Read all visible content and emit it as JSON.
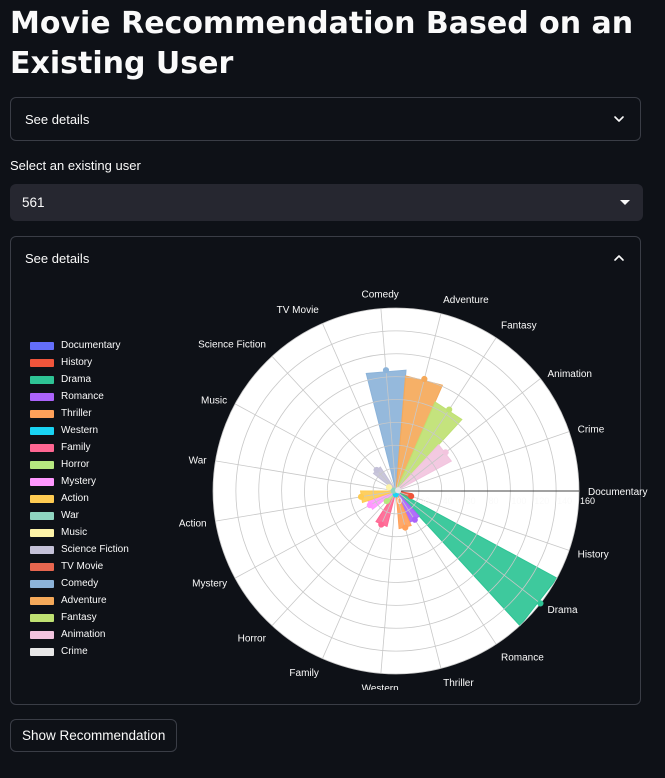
{
  "page": {
    "title": "Movie Recommendation Based on an Existing User"
  },
  "expander_top": {
    "label": "See details",
    "state": "collapsed"
  },
  "user_select": {
    "label": "Select an existing user",
    "value": "561"
  },
  "expander_chart": {
    "label": "See details",
    "state": "expanded"
  },
  "button": {
    "label": "Show Recommendation"
  },
  "chart_data": {
    "type": "radar",
    "title": "",
    "radial_range": [
      0,
      160
    ],
    "radial_ticks": [
      "0",
      "20",
      "40",
      "60",
      "80",
      "100",
      "120",
      "140",
      "160"
    ],
    "grid": true,
    "legend_position": "left",
    "axes": [
      "Documentary",
      "History",
      "Drama",
      "Romance",
      "Thriller",
      "Western",
      "Family",
      "Horror",
      "Mystery",
      "Action",
      "War",
      "Music",
      "Science Fiction",
      "TV Movie",
      "Comedy",
      "Adventure",
      "Fantasy",
      "Animation",
      "Crime"
    ],
    "series": [
      {
        "name": "Documentary",
        "value": 0,
        "color": "#636efa"
      },
      {
        "name": "History",
        "value": 14,
        "color": "#ef553b"
      },
      {
        "name": "Drama",
        "value": 167,
        "color": "#2ec495"
      },
      {
        "name": "Romance",
        "value": 30,
        "color": "#ab63fa"
      },
      {
        "name": "Thriller",
        "value": 33,
        "color": "#ffa15a"
      },
      {
        "name": "Western",
        "value": 3,
        "color": "#19d3f3"
      },
      {
        "name": "Family",
        "value": 32,
        "color": "#ff6692"
      },
      {
        "name": "Horror",
        "value": 12,
        "color": "#b6e880"
      },
      {
        "name": "Mystery",
        "value": 26,
        "color": "#ff97ff"
      },
      {
        "name": "Action",
        "value": 31,
        "color": "#fecb52"
      },
      {
        "name": "War",
        "value": 2,
        "color": "#8fd5c0"
      },
      {
        "name": "Music",
        "value": 7,
        "color": "#fdf3a8"
      },
      {
        "name": "Science Fiction",
        "value": 25,
        "color": "#c4c1d8"
      },
      {
        "name": "TV Movie",
        "value": 0,
        "color": "#e7664f"
      },
      {
        "name": "Comedy",
        "value": 106,
        "color": "#8cb3d9"
      },
      {
        "name": "Adventure",
        "value": 101,
        "color": "#f5a95a"
      },
      {
        "name": "Fantasy",
        "value": 85,
        "color": "#bfe172"
      },
      {
        "name": "Animation",
        "value": 55,
        "color": "#f2c4de"
      },
      {
        "name": "Crime",
        "value": 2,
        "color": "#e7e7e7"
      }
    ]
  }
}
